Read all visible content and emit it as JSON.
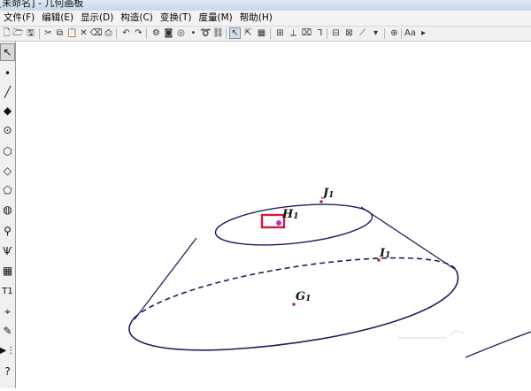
{
  "window": {
    "title": "[未命名] - 几何画板"
  },
  "menu": [
    {
      "label": "文件(F)"
    },
    {
      "label": "编辑(E)"
    },
    {
      "label": "显示(D)"
    },
    {
      "label": "构造(C)"
    },
    {
      "label": "变换(T)"
    },
    {
      "label": "度量(M)"
    },
    {
      "label": "帮助(H)"
    }
  ],
  "toolbar": [
    {
      "name": "new-icon",
      "glyph": "🗋"
    },
    {
      "name": "open-icon",
      "glyph": "🗁"
    },
    {
      "name": "save-icon",
      "glyph": "🖫"
    },
    {
      "name": "cut-icon",
      "glyph": "✂"
    },
    {
      "name": "copy-icon",
      "glyph": "⧉"
    },
    {
      "name": "paste-icon",
      "glyph": "📋"
    },
    {
      "name": "delete-icon",
      "glyph": "✕"
    },
    {
      "name": "erase-icon",
      "glyph": "⌫"
    },
    {
      "name": "print-icon",
      "glyph": "⎙"
    },
    {
      "name": "undo-icon",
      "glyph": "↶"
    },
    {
      "name": "redo-icon",
      "glyph": "↷"
    },
    {
      "name": "settings-icon",
      "glyph": "⚙"
    },
    {
      "name": "camera-icon",
      "glyph": "◙"
    },
    {
      "name": "target-icon",
      "glyph": "◎"
    },
    {
      "name": "point-tool-icon",
      "glyph": "•"
    },
    {
      "name": "animate-icon",
      "glyph": "➰"
    },
    {
      "name": "link-icon",
      "glyph": "⛓"
    },
    {
      "name": "arrow-select-icon",
      "glyph": "↖"
    },
    {
      "name": "select-points-icon",
      "glyph": "⇱"
    },
    {
      "name": "table-icon",
      "glyph": "▦"
    },
    {
      "name": "construct-icon",
      "glyph": "⊞"
    },
    {
      "name": "measure-icon",
      "glyph": "⟂"
    },
    {
      "name": "hide-icon",
      "glyph": "⌧"
    },
    {
      "name": "label-icon",
      "glyph": "Ꞁ"
    },
    {
      "name": "grid-icon",
      "glyph": "⊟"
    },
    {
      "name": "coords-icon",
      "glyph": "⊠"
    },
    {
      "name": "line-style-icon",
      "glyph": "⟋"
    },
    {
      "name": "color-icon",
      "glyph": "▾"
    },
    {
      "name": "center-icon",
      "glyph": "⊕"
    },
    {
      "name": "text-style-icon",
      "glyph": "Aa"
    },
    {
      "name": "more-icon",
      "glyph": "▸"
    }
  ],
  "toolbox": [
    {
      "name": "arrow-tool-icon",
      "glyph": "↖"
    },
    {
      "name": "point-tool-icon",
      "glyph": "•"
    },
    {
      "name": "line-tool-icon",
      "glyph": "╱"
    },
    {
      "name": "polygon-tool-icon",
      "glyph": "◆"
    },
    {
      "name": "compass-tool-icon",
      "glyph": "⊙"
    },
    {
      "name": "cube-tool-icon",
      "glyph": "⬡"
    },
    {
      "name": "diamond-solid-tool-icon",
      "glyph": "◇"
    },
    {
      "name": "prism-tool-icon",
      "glyph": "⬠"
    },
    {
      "name": "sphere-tool-icon",
      "glyph": "◍"
    },
    {
      "name": "transform-tool-icon",
      "glyph": "⚲"
    },
    {
      "name": "custom-tool-icon",
      "glyph": "Ѱ"
    },
    {
      "name": "calculator-tool-icon",
      "glyph": "▦"
    },
    {
      "name": "text-tool-icon",
      "glyph": "T1"
    },
    {
      "name": "marker-tool-icon",
      "glyph": "⌖"
    },
    {
      "name": "pen-tool-icon",
      "glyph": "✎"
    },
    {
      "name": "info-tool-icon",
      "glyph": "▶⋮"
    },
    {
      "name": "help-tool-icon",
      "glyph": "?"
    }
  ],
  "canvas": {
    "labels": {
      "j1": "J",
      "h1": "H",
      "i1": "I",
      "g1": "G",
      "sub": "1"
    },
    "colors": {
      "stroke": "#1f1f5c",
      "point": "#c0282d",
      "highlight": "#d31b3f",
      "selected_point": "#c030c0"
    }
  }
}
